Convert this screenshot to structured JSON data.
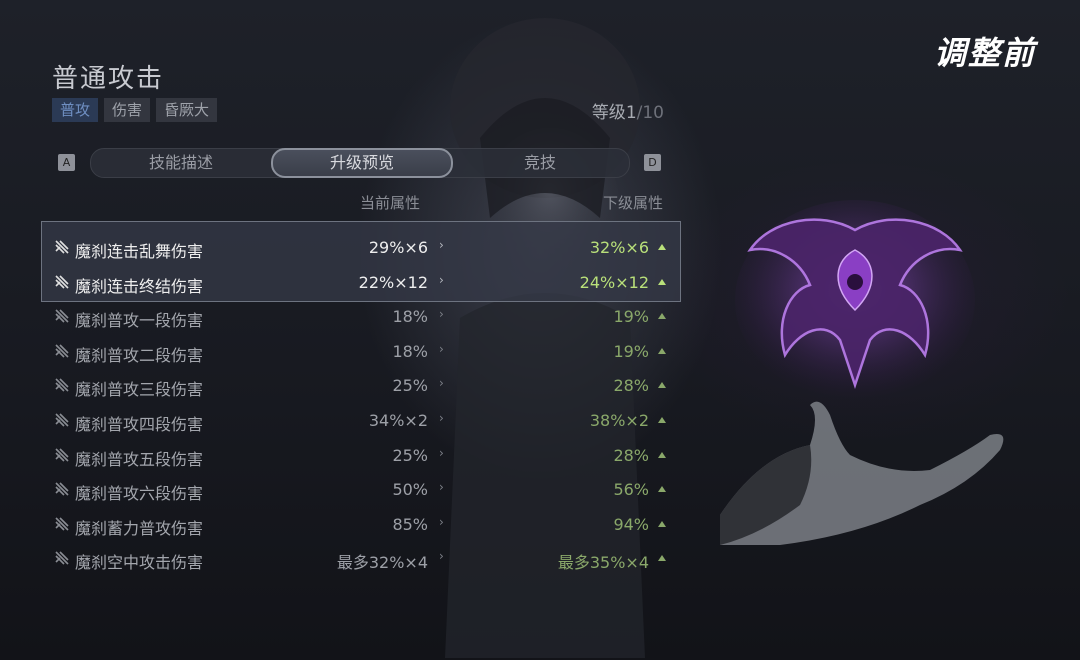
{
  "corner_title": "调整前",
  "skill": {
    "title": "普通攻击",
    "tags": [
      "普攻",
      "伤害",
      "昏厥大"
    ],
    "level_label": "等级",
    "level_current": "1",
    "level_total": "/10"
  },
  "key_left": "A",
  "key_right": "D",
  "tabs": [
    "技能描述",
    "升级预览",
    "竞技"
  ],
  "active_tab": "升级预览",
  "columns": {
    "current": "当前属性",
    "next": "下级属性"
  },
  "rows": [
    {
      "name": "魔刹连击乱舞伤害",
      "current": "29%×6",
      "next": "32%×6"
    },
    {
      "name": "魔刹连击终结伤害",
      "current": "22%×12",
      "next": "24%×12"
    },
    {
      "name": "魔刹普攻一段伤害",
      "current": "18%",
      "next": "19%"
    },
    {
      "name": "魔刹普攻二段伤害",
      "current": "18%",
      "next": "19%"
    },
    {
      "name": "魔刹普攻三段伤害",
      "current": "25%",
      "next": "28%"
    },
    {
      "name": "魔刹普攻四段伤害",
      "current": "34%×2",
      "next": "38%×2"
    },
    {
      "name": "魔刹普攻五段伤害",
      "current": "25%",
      "next": "28%"
    },
    {
      "name": "魔刹普攻六段伤害",
      "current": "50%",
      "next": "56%"
    },
    {
      "name": "魔刹蓄力普攻伤害",
      "current": "85%",
      "next": "94%"
    },
    {
      "name": "魔刹空中攻击伤害",
      "current": "最多32%×4",
      "next": "最多35%×4"
    }
  ],
  "colors": {
    "increase": "#b9e07a",
    "tag_primary": "#2b3a55",
    "emblem": "#7a3fa8"
  }
}
